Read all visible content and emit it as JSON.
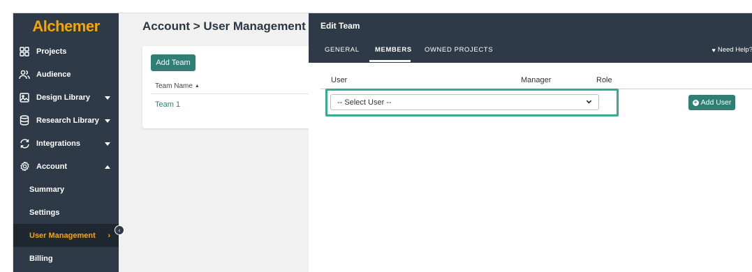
{
  "sidebar": {
    "logo": "Alchemer",
    "items": [
      {
        "label": "Projects"
      },
      {
        "label": "Audience"
      },
      {
        "label": "Design Library"
      },
      {
        "label": "Research Library"
      },
      {
        "label": "Integrations"
      },
      {
        "label": "Account"
      },
      {
        "label": "Summary"
      },
      {
        "label": "Settings"
      },
      {
        "label": "User Management"
      },
      {
        "label": "Billing"
      }
    ]
  },
  "main": {
    "title": "Account > User Management >",
    "add_team_label": "Add Team",
    "column_team_name": "Team Name",
    "teams": [
      "Team 1"
    ]
  },
  "panel": {
    "title": "Edit Team",
    "tabs": [
      "GENERAL",
      "MEMBERS",
      "OWNED PROJECTS"
    ],
    "active_tab": "MEMBERS",
    "help_label": "Need Help?",
    "columns": {
      "user": "User",
      "manager": "Manager",
      "role": "Role"
    },
    "select_user_value": "-- Select User --",
    "add_user_label": "Add User"
  },
  "colors": {
    "sidebar_bg": "#2f3a48",
    "accent_orange": "#f7a600",
    "teal": "#2f7f74",
    "highlight": "#3aa893"
  }
}
